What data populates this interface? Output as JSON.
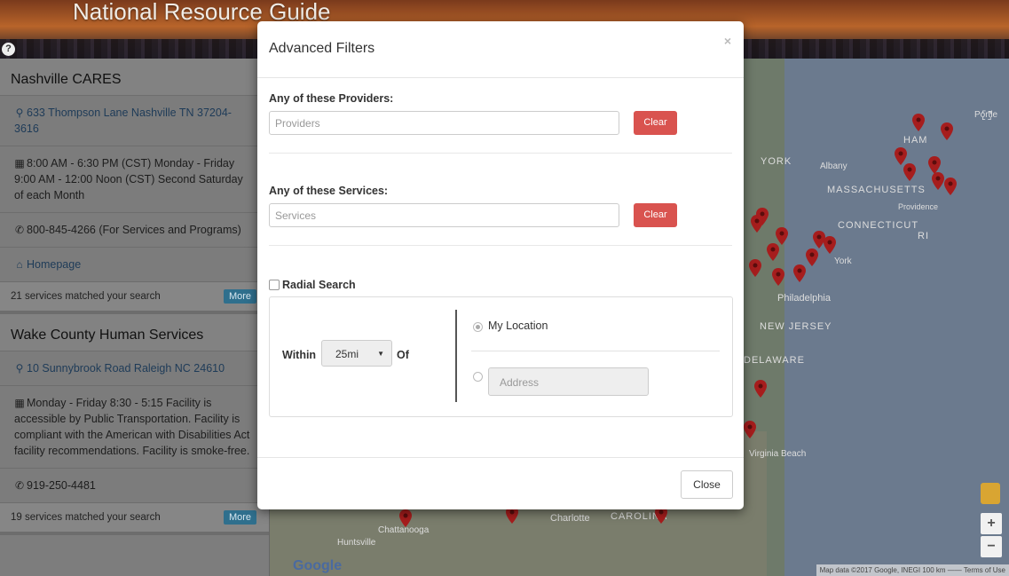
{
  "header": {
    "title": "National Resource Guide",
    "help_symbol": "?"
  },
  "results": [
    {
      "name": "Nashville CARES",
      "address": "633 Thompson Lane Nashville TN 37204-3616",
      "hours": "8:00 AM - 6:30 PM (CST) Monday - Friday 9:00 AM - 12:00 Noon (CST) Second Saturday of each Month",
      "phone": "800-845-4266 (For Services and Programs)",
      "homepage_label": "Homepage",
      "match_text": "21 services matched your search",
      "more_label": "More"
    },
    {
      "name": "Wake County Human Services",
      "address": "10 Sunnybrook Road Raleigh NC 24610",
      "hours": "Monday - Friday 8:30 - 5:15 Facility is accessible by Public Transportation. Facility is compliant with the American with Disabilities Act facility recommendations. Facility is smoke-free.",
      "phone": "919-250-4481",
      "match_text": "19 services matched your search",
      "more_label": "More"
    }
  ],
  "map": {
    "labels": {
      "york": "YORK",
      "albany": "Albany",
      "massachusetts": "MASSACHUSETTS",
      "providence": "Providence",
      "connecticut": "CONNECTICUT",
      "ri": "RI",
      "york2": "York",
      "philadelphia": "Philadelphia",
      "new_jersey": "NEW JERSEY",
      "delaware": "DELAWARE",
      "virginia_beach": "Virginia Beach",
      "charlotte": "Charlotte",
      "carolina": "CAROLINA",
      "chattanooga": "Chattanooga",
      "huntsville": "Huntsville",
      "portland": "Portle",
      "ham": "HAM"
    },
    "google": "Google",
    "footer": "Map data ©2017 Google, INEGI   100 km ——   Terms of Use",
    "zoom_in": "+",
    "zoom_out": "−"
  },
  "modal": {
    "title": "Advanced Filters",
    "close_symbol": "×",
    "providers_label": "Any of these Providers:",
    "providers_placeholder": "Providers",
    "services_label": "Any of these Services:",
    "services_placeholder": "Services",
    "clear_label": "Clear",
    "radial_label": "Radial Search",
    "within_label": "Within",
    "distance_value": "25mi",
    "of_label": "Of",
    "my_location_label": "My Location",
    "address_placeholder": "Address",
    "close_button_label": "Close"
  },
  "colors": {
    "danger": "#d9534f",
    "link": "#1e3b58",
    "more": "#2f6f8d",
    "pin": "#a61d1d"
  }
}
